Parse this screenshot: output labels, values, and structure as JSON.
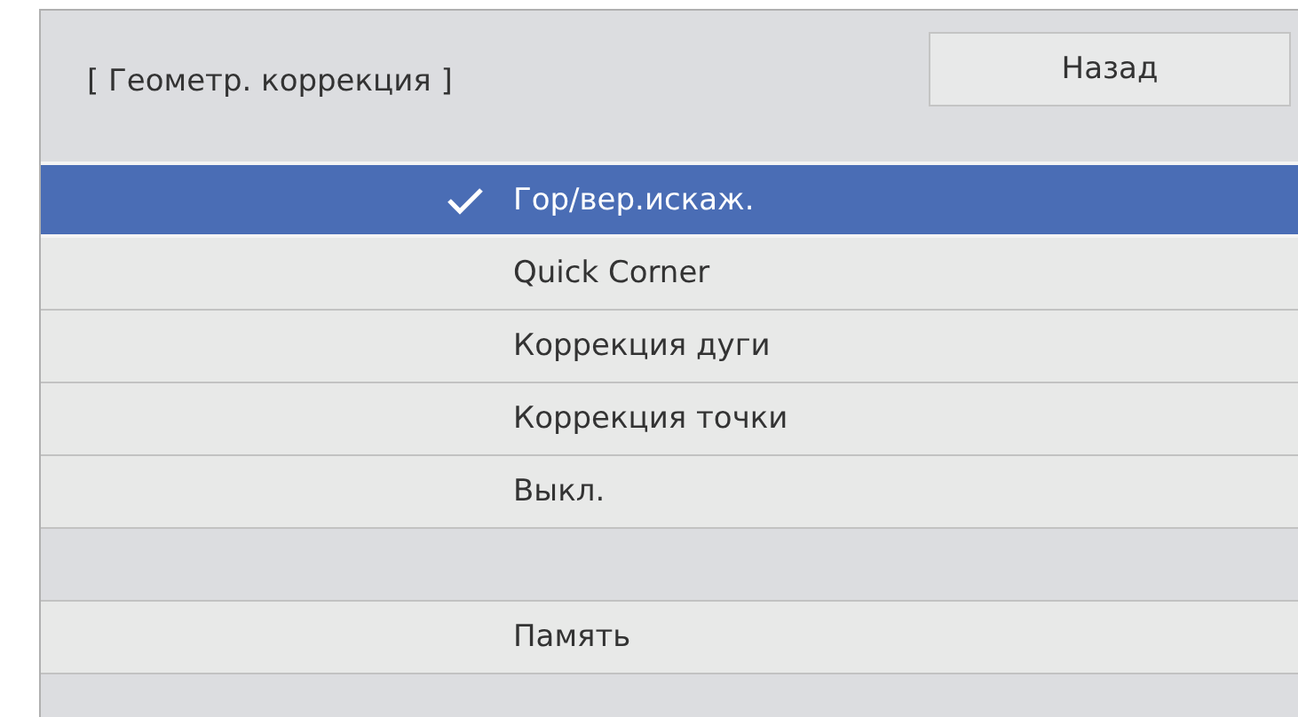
{
  "header": {
    "title": "[ Геометр. коррекция ]",
    "back_button": "Назад"
  },
  "items": [
    {
      "kind": "option",
      "label": "Гор/вер.искаж.",
      "selected": true,
      "checked": true
    },
    {
      "kind": "option",
      "label": "Quick Corner",
      "selected": false,
      "checked": false
    },
    {
      "kind": "option",
      "label": "Коррекция дуги",
      "selected": false,
      "checked": false
    },
    {
      "kind": "option",
      "label": "Коррекция точки",
      "selected": false,
      "checked": false
    },
    {
      "kind": "option",
      "label": "Выкл.",
      "selected": false,
      "checked": false
    },
    {
      "kind": "blank"
    },
    {
      "kind": "option",
      "label": "Память",
      "selected": false,
      "checked": false
    },
    {
      "kind": "blank"
    }
  ]
}
